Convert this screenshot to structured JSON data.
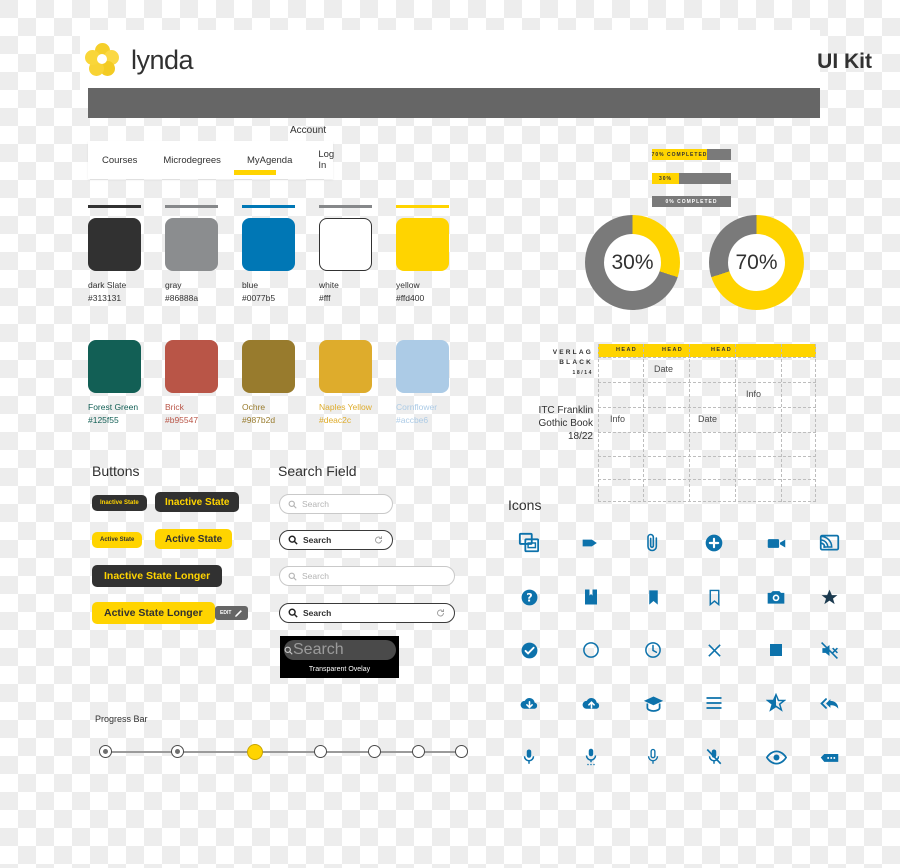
{
  "header": {
    "brand": "lynda",
    "logo_icon": "lynda-flower-logo",
    "kit_title": "UI Kit",
    "logo_color": "#f5cf2a"
  },
  "nav": {
    "account_label": "Account",
    "items": [
      {
        "label": "Courses",
        "active": false
      },
      {
        "label": "Microdegrees",
        "active": false
      },
      {
        "label": "MyAgenda",
        "active": true
      },
      {
        "label": "Log In",
        "active": false
      }
    ],
    "active_underline_color": "#ffd400"
  },
  "palette": {
    "row1": [
      {
        "name": "dark Slate",
        "hex": "#313131",
        "swatch": "#313131",
        "bar": "#313131",
        "text": "#313131"
      },
      {
        "name": "gray",
        "hex": "#86888a",
        "swatch": "#8b8d8f",
        "bar": "#86888a",
        "text": "#313131"
      },
      {
        "name": "blue",
        "hex": "#0077b5",
        "swatch": "#0077b5",
        "bar": "#0077b5",
        "text": "#313131"
      },
      {
        "name": "white",
        "hex": "#fff",
        "swatch": "#ffffff",
        "bar": "#86888a",
        "text": "#313131"
      },
      {
        "name": "yellow",
        "hex": "#ffd400",
        "swatch": "#ffd400",
        "bar": "#ffd400",
        "text": "#313131"
      }
    ],
    "row2": [
      {
        "name": "Forest Green",
        "hex": "#125f55",
        "swatch": "#125f55",
        "text": "#125f55"
      },
      {
        "name": "Brick",
        "hex": "#b95547",
        "swatch": "#b95547",
        "text": "#b95547"
      },
      {
        "name": "Ochre",
        "hex": "#987b2d",
        "swatch": "#987b2d",
        "text": "#987b2d"
      },
      {
        "name": "Naples Yellow",
        "hex": "#deac2c",
        "swatch": "#deac2c",
        "text": "#deac2c"
      },
      {
        "name": "Cornflower",
        "hex": "#accbe6",
        "swatch": "#accbe6",
        "text": "#accbe6"
      }
    ]
  },
  "buttons": {
    "title": "Buttons",
    "items": [
      {
        "label": "Inactive State",
        "state": "inactive",
        "size": "small"
      },
      {
        "label": "Inactive State",
        "state": "inactive",
        "size": "medium"
      },
      {
        "label": "Active State",
        "state": "active",
        "size": "small"
      },
      {
        "label": "Active State",
        "state": "active",
        "size": "medium"
      },
      {
        "label": "Inactive State Longer",
        "state": "inactive",
        "size": "large"
      },
      {
        "label": "Active State Longer",
        "state": "active",
        "size": "large"
      }
    ],
    "edit_button": {
      "label": "EDIT",
      "icon": "pencil-icon"
    }
  },
  "search": {
    "title": "Search Field",
    "fields": [
      {
        "value": "",
        "placeholder": "Search",
        "state": "empty",
        "width": "narrow",
        "refresh": false
      },
      {
        "value": "Search",
        "placeholder": "Search",
        "state": "filled",
        "width": "narrow",
        "refresh": true
      },
      {
        "value": "",
        "placeholder": "Search",
        "state": "empty",
        "width": "wide",
        "refresh": false
      },
      {
        "value": "Search",
        "placeholder": "Search",
        "state": "filled",
        "width": "wide",
        "refresh": true
      }
    ],
    "overlay": {
      "placeholder": "Search",
      "caption": "Transparent Ovelay"
    },
    "icons": {
      "magnifier": "search-icon",
      "refresh": "refresh-icon"
    }
  },
  "progress": {
    "title": "Progress Bar",
    "steps": [
      {
        "state": "done"
      },
      {
        "state": "done"
      },
      {
        "state": "current"
      },
      {
        "state": "todo"
      },
      {
        "state": "todo"
      },
      {
        "state": "todo"
      },
      {
        "state": "todo"
      }
    ],
    "current_color": "#ffd400"
  },
  "completion_bars": [
    {
      "label": "70% COMPLETED",
      "percent": 70,
      "label_on_fill": true
    },
    {
      "label": "30%",
      "percent": 30,
      "label_on_fill": true
    },
    {
      "label": "0% COMPLETED",
      "percent": 0,
      "label_on_fill": false
    }
  ],
  "donuts": [
    {
      "label": "30%",
      "percent": 30,
      "fill": "#ffd400",
      "track": "#7a7a7a"
    },
    {
      "label": "70%",
      "percent": 70,
      "fill": "#ffd400",
      "track": "#7a7a7a"
    }
  ],
  "typography": {
    "display": {
      "line1": "VERLAG",
      "line2": "BLACK",
      "line3": "18/14"
    },
    "body": {
      "line1": "ITC Franklin",
      "line2": "Gothic Book",
      "line3": "18/22"
    }
  },
  "table": {
    "headers": [
      "HEAD",
      "HEAD",
      "HEAD",
      "",
      ""
    ],
    "header_bg": "#ffd400",
    "cells": [
      {
        "text": "Date",
        "col": 2,
        "row": 1
      },
      {
        "text": "Info",
        "col": 4,
        "row": 2
      },
      {
        "text": "Info",
        "col": 1,
        "row": 3
      },
      {
        "text": "Date",
        "col": 3,
        "row": 3
      }
    ]
  },
  "icons": {
    "title": "Icons",
    "color": "#0d72ab",
    "grid": [
      [
        "copy-windows-icon",
        "tag-icon",
        "paperclip-icon",
        "add-circle-icon",
        "videocam-icon",
        "cast-screen-icon"
      ],
      [
        "help-circle-icon",
        "book-icon",
        "bookmark-filled-icon",
        "bookmark-outline-icon",
        "camera-icon",
        "star-filled-icon"
      ],
      [
        "check-circle-icon",
        "circle-outline-icon",
        "clock-icon",
        "close-x-icon",
        "stop-square-icon",
        "volume-mute-icon"
      ],
      [
        "cloud-download-icon",
        "cloud-upload-icon",
        "graduation-cap-icon",
        "menu-hamburger-icon",
        "star-half-icon",
        "reply-all-icon"
      ],
      [
        "mic-filled-icon",
        "mic-settings-icon",
        "mic-outline-icon",
        "mic-off-icon",
        "eye-icon",
        "comment-dots-icon"
      ]
    ]
  }
}
